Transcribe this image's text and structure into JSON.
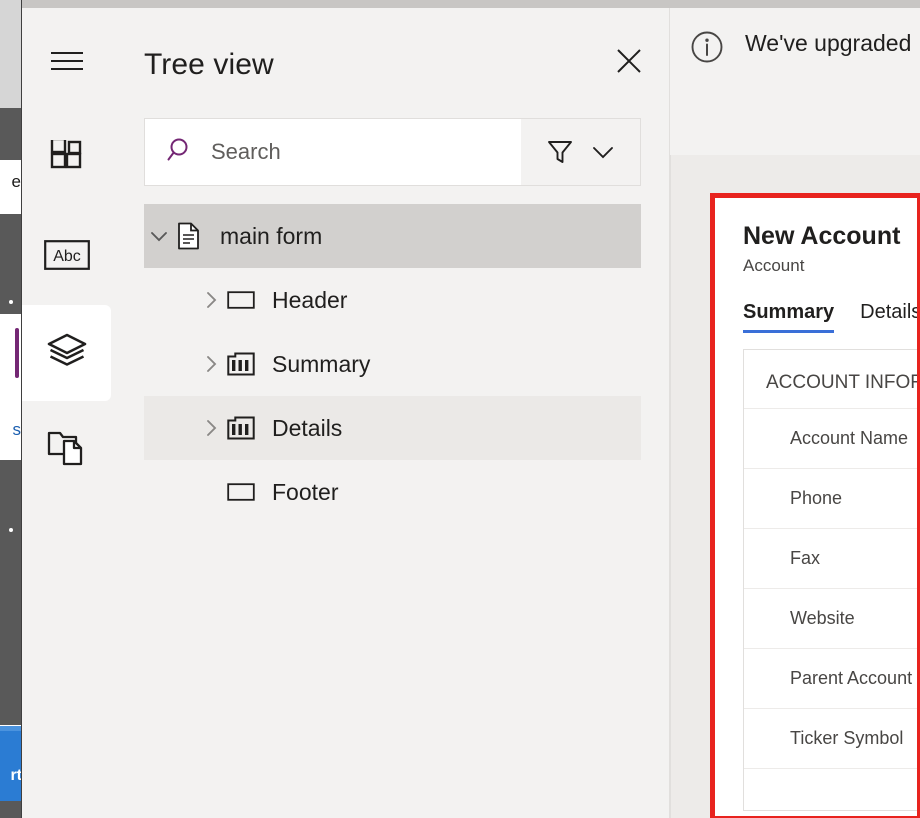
{
  "window": {
    "left_edge_labels": [
      "e",
      "s",
      "rt"
    ],
    "accent_purple": "#742774",
    "highlight_red": "#e8231e",
    "tab_accent_blue": "#3a6fd8"
  },
  "rail": {
    "items": [
      {
        "name": "menu",
        "icon": "hamburger-icon",
        "label": "",
        "selected": false
      },
      {
        "name": "components",
        "icon": "components-icon",
        "label": "",
        "selected": false
      },
      {
        "name": "text-field",
        "icon": "abc-icon",
        "label": "Abc",
        "selected": false
      },
      {
        "name": "tree-view",
        "icon": "layers-icon",
        "label": "",
        "selected": true
      },
      {
        "name": "pages",
        "icon": "folder-page-icon",
        "label": "",
        "selected": false
      }
    ]
  },
  "tree_panel": {
    "title": "Tree view",
    "close_label": "Close",
    "search": {
      "placeholder": "Search",
      "value": ""
    },
    "filter_label": "Filter",
    "chevron_label": "Expand",
    "nodes": [
      {
        "label": "main form",
        "icon": "form-document-icon",
        "twisty": "chevron-down",
        "indent": 0,
        "state": "selected"
      },
      {
        "label": "Header",
        "icon": "section-rect-icon",
        "twisty": "chevron-right",
        "indent": 1,
        "state": "normal"
      },
      {
        "label": "Summary",
        "icon": "columns-icon",
        "twisty": "chevron-right",
        "indent": 1,
        "state": "normal"
      },
      {
        "label": "Details",
        "icon": "columns-icon",
        "twisty": "chevron-right",
        "indent": 1,
        "state": "hover"
      },
      {
        "label": "Footer",
        "icon": "section-rect-icon",
        "twisty": "none",
        "indent": 1,
        "state": "normal"
      }
    ]
  },
  "canvas": {
    "banner": {
      "icon": "info-icon",
      "text": "We've upgraded"
    },
    "form_preview": {
      "title": "New Account",
      "subtitle": "Account",
      "tabs": [
        {
          "label": "Summary",
          "active": true
        },
        {
          "label": "Details",
          "active": false
        }
      ],
      "section_title": "ACCOUNT INFORMATION",
      "fields": [
        {
          "label": "Account Name",
          "value": ""
        },
        {
          "label": "Phone",
          "value": ""
        },
        {
          "label": "Fax",
          "value": ""
        },
        {
          "label": "Website",
          "value": ""
        },
        {
          "label": "Parent Account",
          "value": ""
        },
        {
          "label": "Ticker Symbol",
          "value": ""
        }
      ]
    }
  }
}
